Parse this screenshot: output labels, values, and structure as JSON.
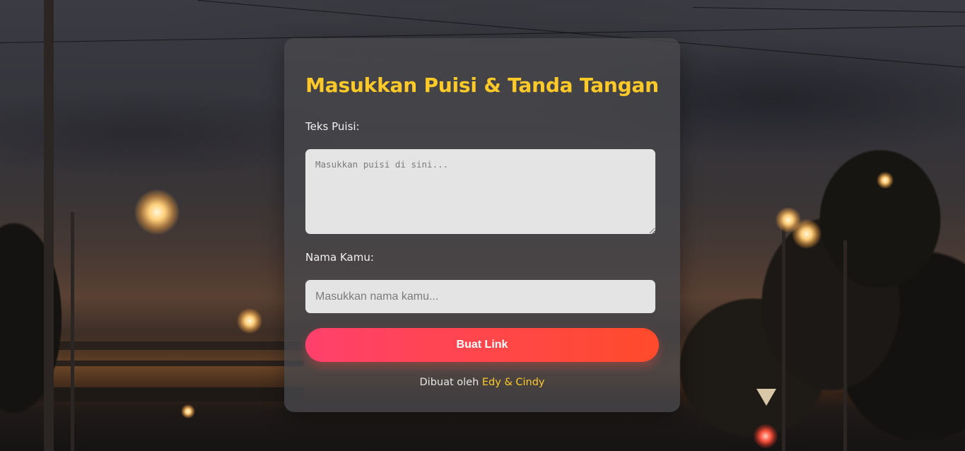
{
  "form": {
    "title": "Masukkan Puisi & Tanda Tangan",
    "poem_label": "Teks Puisi:",
    "poem_placeholder": "Masukkan puisi di sini...",
    "poem_value": "",
    "name_label": "Nama Kamu:",
    "name_placeholder": "Masukkan nama kamu...",
    "name_value": "",
    "submit_label": "Buat Link"
  },
  "footer": {
    "prefix": "Dibuat oleh",
    "authors": "Edy & Cindy"
  },
  "colors": {
    "title": "#ffc928",
    "button_start": "#ff416c",
    "button_end": "#ff4b2b",
    "authors": "#ffc928"
  }
}
